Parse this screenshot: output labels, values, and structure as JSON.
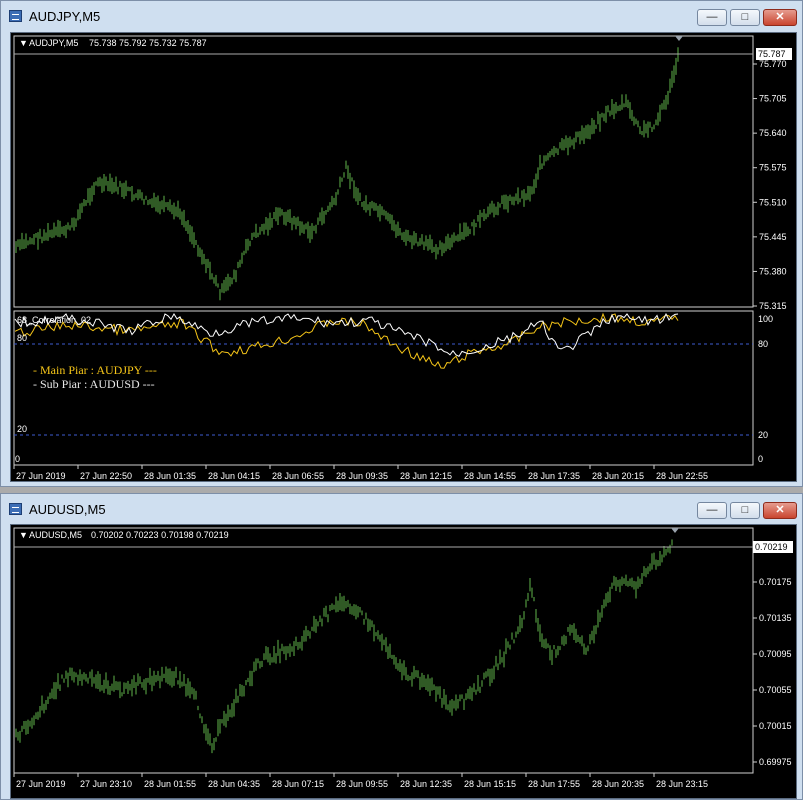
{
  "windows": [
    {
      "title": "AUDJPY,M5",
      "header_symbol": "AUDJPY,M5",
      "header_ohlc": "75.738 75.792 75.732 75.787",
      "current_price": "75.787",
      "price_ticks": [
        "75.770",
        "75.705",
        "75.640",
        "75.575",
        "75.510",
        "75.445",
        "75.380",
        "75.315"
      ],
      "time_ticks": [
        "27 Jun 2019",
        "27 Jun 22:50",
        "28 Jun 01:35",
        "28 Jun 04:15",
        "28 Jun 06:55",
        "28 Jun 09:35",
        "28 Jun 12:15",
        "28 Jun 14:55",
        "28 Jun 17:35",
        "28 Jun 20:15",
        "28 Jun 22:55"
      ],
      "indicator": {
        "name": "68_Correlation_02",
        "left_levels": [
          "80",
          "20",
          "0"
        ],
        "right_levels": [
          "100",
          "80",
          "20",
          "0"
        ],
        "main_pair": "- Main Piar : AUDJPY ---",
        "sub_pair": "- Sub Piar  : AUDUSD ---"
      }
    },
    {
      "title": "AUDUSD,M5",
      "header_symbol": "AUDUSD,M5",
      "header_ohlc": "0.70202 0.70223 0.70198 0.70219",
      "current_price": "0.70219",
      "price_ticks": [
        "0.70175",
        "0.70135",
        "0.70095",
        "0.70055",
        "0.70015",
        "0.69975"
      ],
      "time_ticks": [
        "27 Jun 2019",
        "27 Jun 23:10",
        "28 Jun 01:55",
        "28 Jun 04:35",
        "28 Jun 07:15",
        "28 Jun 09:55",
        "28 Jun 12:35",
        "28 Jun 15:15",
        "28 Jun 17:55",
        "28 Jun 20:35",
        "28 Jun 23:15"
      ]
    }
  ],
  "colors": {
    "bars": "#5fb34a",
    "main_pair_line": "#f5c518",
    "sub_pair_line": "#ffffff",
    "level_line": "#3e5bd0",
    "main_pair_text": "#f5c518",
    "sub_pair_text": "#e8e8e8"
  }
}
